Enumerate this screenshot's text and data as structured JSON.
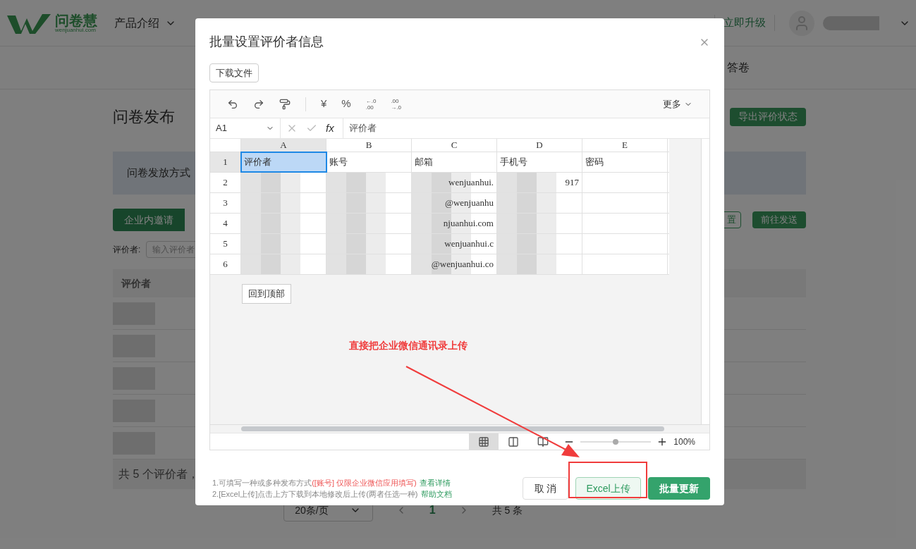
{
  "header": {
    "logo": {
      "name": "问卷慧",
      "domain": "wenjuanhui.com"
    },
    "menu": "产品介绍",
    "upgrade": "立即升级"
  },
  "subnav": {
    "tab": "答卷"
  },
  "page": {
    "title": "问卷发布",
    "export_button": "导出评价状态",
    "info": "问卷发放方式",
    "tab": "企业内邀请",
    "settings_button": "置",
    "send_button": "前往发送",
    "filter_label": "评价者:",
    "filter_placeholder": "输入评价者",
    "table_header": "评价者",
    "rows": [
      {
        "redacted": true
      },
      {
        "redacted": true
      },
      {
        "redacted": true
      },
      {
        "redacted": true
      },
      {
        "redacted": true
      }
    ],
    "summary": "共 5 个评价者，",
    "pagination": {
      "page_size": "20条/页",
      "page": "1",
      "total": "共 5 条"
    }
  },
  "dialog": {
    "title": "批量设置评价者信息",
    "download_button": "下载文件",
    "toolbar": [
      {
        "kind": "undo"
      },
      {
        "kind": "redo"
      },
      {
        "kind": "format-painter"
      },
      {
        "kind": "separator"
      },
      {
        "kind": "text",
        "label": "¥"
      },
      {
        "kind": "text",
        "label": "%"
      },
      {
        "kind": "decimal",
        "lines": [
          "←.0",
          ".00"
        ]
      },
      {
        "kind": "decimal",
        "lines": [
          ".00",
          "→.0"
        ]
      }
    ],
    "more": "更多",
    "cell_ref": "A1",
    "function_label": "fx",
    "formula": "评价者",
    "columns": [
      "A",
      "B",
      "C",
      "D",
      "E"
    ],
    "rows": [
      {
        "number": "1",
        "cells": [
          {
            "text": "评价者",
            "selected": true
          },
          {
            "text": "账号",
            "selected": false
          },
          {
            "text": "邮箱",
            "selected": false
          },
          {
            "text": "手机号",
            "selected": false
          },
          {
            "text": "密码",
            "selected": false
          }
        ]
      },
      {
        "number": "2",
        "cells": [
          {
            "redacted": true,
            "selected": false
          },
          {
            "redacted": true,
            "selected": false
          },
          {
            "text": "wenjuanhui.",
            "redacted": true,
            "selected": false
          },
          {
            "text": "917",
            "redacted": true,
            "selected": false
          },
          {
            "selected": false
          }
        ]
      },
      {
        "number": "3",
        "cells": [
          {
            "redacted": true,
            "selected": false
          },
          {
            "redacted": true,
            "selected": false
          },
          {
            "text": "@wenjuanhu",
            "redacted": true,
            "selected": false
          },
          {
            "redacted": true,
            "selected": false
          },
          {
            "selected": false
          }
        ]
      },
      {
        "number": "4",
        "cells": [
          {
            "redacted": true,
            "selected": false
          },
          {
            "redacted": true,
            "selected": false
          },
          {
            "text": "njuanhui.com",
            "redacted": true,
            "selected": false
          },
          {
            "redacted": true,
            "selected": false
          },
          {
            "selected": false
          }
        ]
      },
      {
        "number": "5",
        "cells": [
          {
            "redacted": true,
            "selected": false
          },
          {
            "redacted": true,
            "selected": false
          },
          {
            "text": "wenjuanhui.c",
            "redacted": true,
            "selected": false
          },
          {
            "redacted": true,
            "selected": false
          },
          {
            "selected": false
          }
        ]
      },
      {
        "number": "6",
        "cells": [
          {
            "redacted": true,
            "selected": false
          },
          {
            "redacted": true,
            "selected": false
          },
          {
            "text": "@wenjuanhui.co",
            "redacted": true,
            "selected": false
          },
          {
            "redacted": true,
            "selected": false
          },
          {
            "selected": false
          }
        ]
      }
    ],
    "back_to_top": "回到顶部",
    "views": [
      {
        "kind": "grid",
        "selected": true
      },
      {
        "kind": "page-break",
        "selected": false
      },
      {
        "kind": "page-layout",
        "selected": false
      }
    ],
    "zoom": {
      "level": 0.5,
      "reading": "100%"
    },
    "notes": [
      {
        "text": "1.可填写一种或多种发布方式",
        "warning": "([账号] 仅限企业微信应用填写)",
        "link": "查看详情"
      },
      {
        "text": "2.[Excel上传]点击上方下载到本地修改后上传(两者任选一种)",
        "link": "帮助文档"
      }
    ],
    "cancel_button": "取 消",
    "upload_button": "Excel上传",
    "update_button": "批量更新"
  },
  "annotation": {
    "text": "直接把企业微信通讯录上传"
  }
}
